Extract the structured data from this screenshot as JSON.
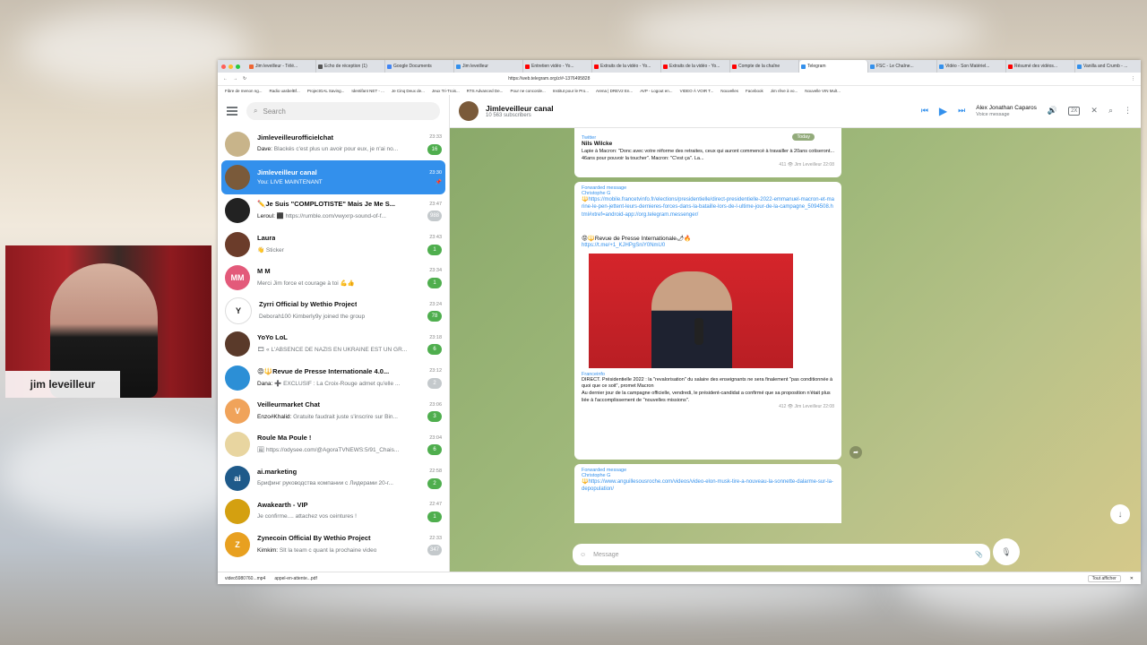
{
  "browser": {
    "tabs": [
      {
        "label": "Jim leveilleur - Télé...",
        "color": "#e63"
      },
      {
        "label": "Echo de réception (1)",
        "color": "#555"
      },
      {
        "label": "Google Documents",
        "color": "#4285f4"
      },
      {
        "label": "Jim leveilleur",
        "color": "#3390ec"
      },
      {
        "label": "Entretien vidéo - Yo...",
        "color": "#f00"
      },
      {
        "label": "Extraits de la vidéo - Yo...",
        "color": "#f00"
      },
      {
        "label": "Extraits de la vidéo - Yo...",
        "color": "#f00"
      },
      {
        "label": "Compte de la chaîne",
        "color": "#f00"
      },
      {
        "label": "Telegram",
        "color": "#3390ec",
        "active": true
      },
      {
        "label": "FSC - Le Chaîne...",
        "color": "#3390ec"
      },
      {
        "label": "Vidéo - Son Matériel...",
        "color": "#3390ec"
      },
      {
        "label": "Résumé des vidéos...",
        "color": "#f00"
      },
      {
        "label": "Vanilla and Crumb - ...",
        "color": "#3390ec"
      }
    ],
    "url": "https://web.telegram.org/z/#-1376495828",
    "bookmarks": [
      "Fibre de menon ng...",
      "Radio uasbelBf...",
      "ProjectGAL Saving...",
      "Identifant NET - ...",
      "Je Cinq Deux de...",
      "Jeux Tri-Trois...",
      "RTS Advanced De...",
      "Pour ne concorde...",
      "Institut pour le Pro...",
      "Arena | DREV2 En...",
      "AVP - Logout en...",
      "VIDEO À VOIR T...",
      "Nouvelles",
      "Facebook",
      "Jim rêve à vo...",
      "Nouvelle VIN Mult..."
    ],
    "downloads": [
      "video5980760...mp4",
      "appel-en-attente...pdf"
    ],
    "show_all": "Tout afficher"
  },
  "telegram": {
    "search_placeholder": "Search",
    "chats": [
      {
        "name": "Jimleveilleurofficielchat",
        "time": "23:33",
        "sender": "Dave:",
        "preview": "Blackés c'est plus un avoir pour eux, je n'ai no...",
        "badge": "16",
        "avatar_color": "#c8b48a",
        "avatar_text": ""
      },
      {
        "name": "Jimleveilleur canal",
        "time": "23:30",
        "sender": "You:",
        "preview": "LIVE MAINTENANT",
        "badge": "",
        "avatar_color": "#7a5a3a",
        "avatar_text": "",
        "selected": true
      },
      {
        "name": "✏️Je Suis \"COMPLOTISTE\" Mais Je Me S...",
        "time": "23:47",
        "sender": "Leroul:",
        "preview": "⬛ https://rumble.com/vwyxrp-sound-of-f...",
        "badge": "988",
        "avatar_color": "#222",
        "avatar_text": "",
        "mute": true
      },
      {
        "name": "Laura",
        "time": "23:43",
        "sender": "",
        "preview": "👋 Sticker",
        "badge": "1",
        "avatar_color": "#6b3c2a",
        "avatar_text": ""
      },
      {
        "name": "M M",
        "time": "23:34",
        "sender": "",
        "preview": "Merci Jim force et courage à toi 💪👍",
        "badge": "1",
        "avatar_color": "#e35a7a",
        "avatar_text": "MM"
      },
      {
        "name": "Zyrri Official by Wethio Project",
        "time": "23:24",
        "sender": "",
        "preview": "Deborah100 Kimberly9y joined the group",
        "badge": "78",
        "avatar_color": "#fff",
        "avatar_text": "Y"
      },
      {
        "name": "YoYo LoL",
        "time": "23:18",
        "sender": "",
        "preview": "🎞 « L'ABSENCE DE NAZIS EN UKRAINE EST UN GR...",
        "badge": "6",
        "avatar_color": "#5a3a2a",
        "avatar_text": ""
      },
      {
        "name": "😡🔱Revue de Presse Internationale 4.0...",
        "time": "23:12",
        "sender": "Dana:",
        "preview": "➕ EXCLUSIF : La Croix-Rouge admet qu'elle ...",
        "badge": "2",
        "avatar_color": "#2c8fd6",
        "avatar_text": "",
        "mute": true
      },
      {
        "name": "Veilleurmarket Chat",
        "time": "23:06",
        "sender": "Enzo#Khalid:",
        "preview": "Gratuite faudrait juste s'inscrire sur Bin...",
        "badge": "3",
        "avatar_color": "#f0a35a",
        "avatar_text": "V"
      },
      {
        "name": "Roule Ma Poule !",
        "time": "23:04",
        "sender": "",
        "preview": "🖼 https://odysee.com/@AgoraTVNEWS:5/91_Chais...",
        "badge": "6",
        "avatar_color": "#e8d5a0",
        "avatar_text": ""
      },
      {
        "name": "ai.marketing",
        "time": "22:58",
        "sender": "",
        "preview": "Брифинг руководства компании с Лидерами 20-г...",
        "badge": "2",
        "avatar_color": "#1e5a8a",
        "avatar_text": "ai"
      },
      {
        "name": "Awakearth - VIP",
        "time": "22:47",
        "sender": "",
        "preview": "Je confirme.... attachez vos ceintures !",
        "badge": "1",
        "avatar_color": "#d4a010",
        "avatar_text": ""
      },
      {
        "name": "Zynecoin Official By Wethio Project",
        "time": "22:33",
        "sender": "Kimkim:",
        "preview": "Slt la team c quant la prochaine video",
        "badge": "347",
        "avatar_color": "#e8a020",
        "avatar_text": "Z",
        "mute": true
      }
    ],
    "header": {
      "title": "Jimleveilleur canal",
      "subtitle": "10 563 subscribers"
    },
    "player": {
      "name": "Alex Jonathan Caparos",
      "sub": "Voice message",
      "speed": "2X"
    },
    "messages": {
      "m1": {
        "badge": "Today",
        "source": "Twitter",
        "author": "Nils Wilcke",
        "text": "Lapie à Macron: \"Donc avec votre réforme des retraites, ceux qui auront commencé à travailler à 20ans cotiseront... 46ans pour pouvoir la toucher\". Macron: \"C'est ça\". La...",
        "meta": "411 👁 Jim Leveilleur 22:08"
      },
      "m2": {
        "forwarded": "Forwarded message",
        "from": "Christophe G",
        "link1": "🔱https://mobile.francetvinfo.fr/elections/presidentielle/direct-presidentielle-2022-emmanuel-macron-et-marine-le-pen-jettent-leurs-dernieres-forces-dans-la-bataille-lors-de-l-ultime-jour-de-la-campagne_5094508.html#xtref=android-app://org.telegram.messenger/",
        "title": "😡🔱Revue de Presse Internationale🌶🔥",
        "link2": "https://t.me/+1_KJHPgSniY0NmU0",
        "source": "Franceinfo",
        "desc": "DIRECT. Présidentielle 2022 : la \"revalorisation\" du salaire des enseignants ne sera finalement \"pas conditionnée à quoi que ce soit\", promet Macron",
        "desc2": "Au dernier jour de la campagne officielle, vendredi, le président-candidat a confirmé que sa proposition n'était plus liée à l'accomplissement de \"nouvelles missions\".",
        "meta": "412 👁 Jim Leveilleur 22:08"
      },
      "m3": {
        "forwarded": "Forwarded message",
        "from": "Christophe G",
        "link": "🔱https://www.anguillesousroche.com/videos/video-elon-musk-tire-a-nouveau-la-sonnette-dalarme-sur-la-depopulation/"
      }
    },
    "composer_placeholder": "Message"
  },
  "webcam": {
    "name": "jim leveilleur"
  }
}
